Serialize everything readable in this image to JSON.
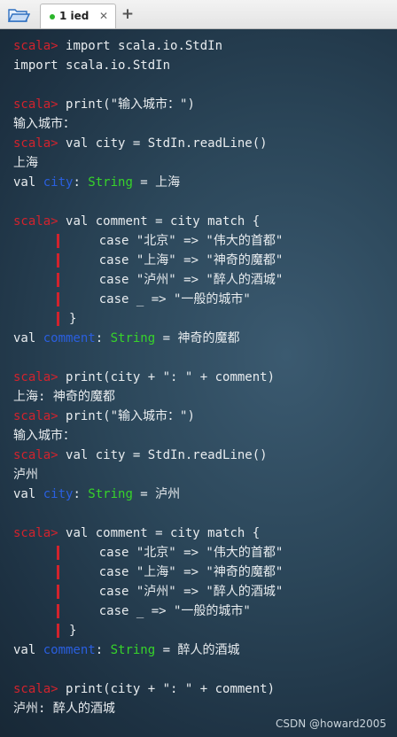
{
  "tabbar": {
    "folder_icon": "folder-icon",
    "tab": {
      "label": "1 ied",
      "status_color": "#2bb52b",
      "close_glyph": "✕"
    },
    "add_glyph": "+"
  },
  "terminal": {
    "prompt": "scala>",
    "lines": [
      {
        "type": "cmd",
        "text": "import scala.io.StdIn"
      },
      {
        "type": "out",
        "text": "import scala.io.StdIn"
      },
      {
        "type": "blank"
      },
      {
        "type": "cmd",
        "text": "print(\"输入城市：\")"
      },
      {
        "type": "out",
        "text": "输入城市："
      },
      {
        "type": "cmd",
        "text": "val city = StdIn.readLine()"
      },
      {
        "type": "out",
        "text": "上海"
      },
      {
        "type": "res",
        "name": "city",
        "vtype": "String",
        "value": "上海"
      },
      {
        "type": "blank"
      },
      {
        "type": "cmd",
        "text": "val comment = city match {"
      },
      {
        "type": "cont",
        "text": "    case \"北京\" => \"伟大的首都\""
      },
      {
        "type": "cont",
        "text": "    case \"上海\" => \"神奇的魔都\""
      },
      {
        "type": "cont",
        "text": "    case \"泸州\" => \"醉人的酒城\""
      },
      {
        "type": "cont",
        "text": "    case _ => \"一般的城市\""
      },
      {
        "type": "cont",
        "text": "}"
      },
      {
        "type": "res",
        "name": "comment",
        "vtype": "String",
        "value": "神奇的魔都"
      },
      {
        "type": "blank"
      },
      {
        "type": "cmd",
        "text": "print(city + \": \" + comment)"
      },
      {
        "type": "out",
        "text": "上海: 神奇的魔都"
      },
      {
        "type": "cmd",
        "text": "print(\"输入城市：\")"
      },
      {
        "type": "out",
        "text": "输入城市："
      },
      {
        "type": "cmd",
        "text": "val city = StdIn.readLine()"
      },
      {
        "type": "out",
        "text": "泸州"
      },
      {
        "type": "res",
        "name": "city",
        "vtype": "String",
        "value": "泸州"
      },
      {
        "type": "blank"
      },
      {
        "type": "cmd",
        "text": "val comment = city match {"
      },
      {
        "type": "cont",
        "text": "    case \"北京\" => \"伟大的首都\""
      },
      {
        "type": "cont",
        "text": "    case \"上海\" => \"神奇的魔都\""
      },
      {
        "type": "cont",
        "text": "    case \"泸州\" => \"醉人的酒城\""
      },
      {
        "type": "cont",
        "text": "    case _ => \"一般的城市\""
      },
      {
        "type": "cont",
        "text": "}"
      },
      {
        "type": "res",
        "name": "comment",
        "vtype": "String",
        "value": "醉人的酒城"
      },
      {
        "type": "blank"
      },
      {
        "type": "cmd",
        "text": "print(city + \": \" + comment)"
      },
      {
        "type": "out",
        "text": "泸州: 醉人的酒城"
      }
    ]
  },
  "watermark": "CSDN @howard2005",
  "colors": {
    "prompt": "#d2232d",
    "val_name": "#2a5fe0",
    "type_name": "#37d42a",
    "text": "#e8ecef"
  }
}
